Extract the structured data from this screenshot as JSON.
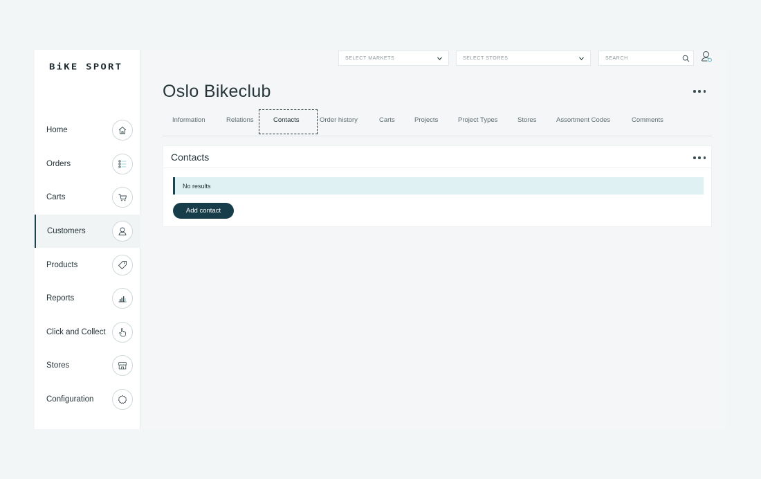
{
  "brand": {
    "logo": "BiKE SPORT"
  },
  "sidebar": {
    "items": [
      {
        "label": "Home",
        "icon": "home-icon"
      },
      {
        "label": "Orders",
        "icon": "list-icon"
      },
      {
        "label": "Carts",
        "icon": "cart-icon"
      },
      {
        "label": "Customers",
        "icon": "user-icon",
        "active": true
      },
      {
        "label": "Products",
        "icon": "tag-icon"
      },
      {
        "label": "Reports",
        "icon": "bar-chart-icon"
      },
      {
        "label": "Click and Collect",
        "icon": "hand-pointer-icon"
      },
      {
        "label": "Stores",
        "icon": "storefront-icon"
      },
      {
        "label": "Configuration",
        "icon": "gear-icon"
      }
    ]
  },
  "topbar": {
    "markets_placeholder": "SELECT MARKETS",
    "stores_placeholder": "SELECT STORES",
    "search_placeholder": "SEARCH"
  },
  "page": {
    "title": "Oslo Bikeclub",
    "tabs": [
      {
        "label": "Information"
      },
      {
        "label": "Relations"
      },
      {
        "label": "Contacts",
        "active": true
      },
      {
        "label": "Order history"
      },
      {
        "label": "Carts"
      },
      {
        "label": "Projects"
      },
      {
        "label": "Project Types"
      },
      {
        "label": "Stores"
      },
      {
        "label": "Assortment Codes"
      },
      {
        "label": "Comments"
      }
    ]
  },
  "contacts_card": {
    "title": "Contacts",
    "empty_message": "No results",
    "add_button": "Add contact"
  },
  "colors": {
    "accent": "#173d4a",
    "notice_bg": "#dff1f3",
    "page_bg": "#f4f6f7"
  }
}
